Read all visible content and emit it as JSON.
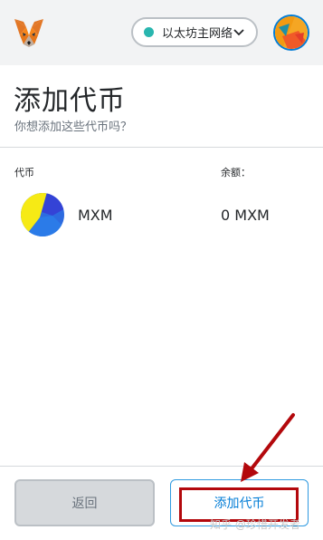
{
  "header": {
    "network_label": "以太坊主网络",
    "network_color": "#29b6af"
  },
  "page": {
    "title": "添加代币",
    "subtitle": "你想添加这些代币吗？"
  },
  "table": {
    "columns": [
      "代币",
      "余额："
    ],
    "rows": [
      {
        "symbol": "MXM",
        "balance": "0 MXM",
        "icon": "mxm-token-icon"
      }
    ]
  },
  "footer": {
    "back_label": "返回",
    "add_label": "添加代币"
  },
  "watermark": "知乎 @珍惜开发者",
  "colors": {
    "accent": "#037dd6",
    "annotation": "#b3080c"
  }
}
